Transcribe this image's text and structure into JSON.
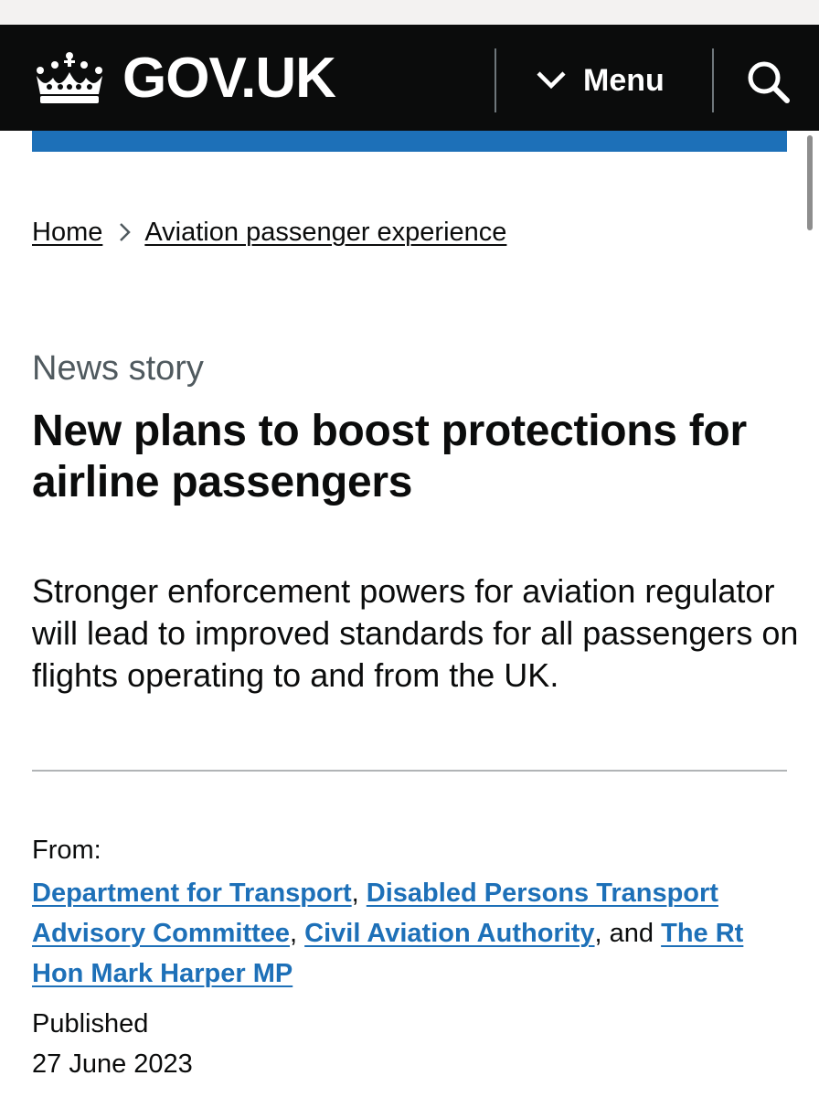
{
  "header": {
    "logo_text": "GOV.UK",
    "menu_label": "Menu",
    "icons": {
      "logo": "crown-icon",
      "menu": "chevron-down-icon",
      "search": "search-icon"
    },
    "colors": {
      "header_bg": "#0b0c0c",
      "accent_bar": "#1d70b8"
    }
  },
  "breadcrumb": {
    "items": [
      {
        "label": "Home"
      },
      {
        "label": "Aviation passenger experience"
      }
    ]
  },
  "article": {
    "document_type": "News story",
    "title": "New plans to boost protections for airline passengers",
    "lead": "Stronger enforcement powers for aviation regulator will lead to improved standards for all passengers on flights operating to and from the UK.",
    "from_label": "From:",
    "from": [
      {
        "label": "Department for Transport"
      },
      {
        "label": "Disabled Persons Transport Advisory Committee"
      },
      {
        "label": "Civil Aviation Authority"
      },
      {
        "label": "The Rt Hon Mark Harper MP"
      }
    ],
    "separators": {
      "comma": ",",
      "and": "and"
    },
    "published_label": "Published",
    "published_date": "27 June 2023",
    "link_color": "#1d70b8"
  }
}
